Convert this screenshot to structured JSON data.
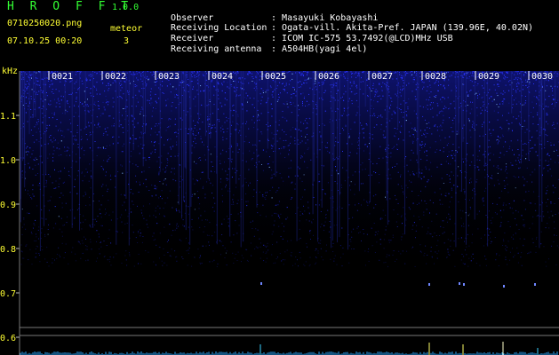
{
  "app": {
    "title": "H R O F F T",
    "version": "1.0.0"
  },
  "file": {
    "name": "0710250020.png",
    "datetime": "07.10.25 00:20"
  },
  "meteor": {
    "label": "meteor",
    "count": "3"
  },
  "info": [
    {
      "key": "Observer",
      "value": "Masayuki Kobayashi"
    },
    {
      "key": "Receiving Location",
      "value": "Ogata-vill. Akita-Pref. JAPAN (139.96E, 40.02N)"
    },
    {
      "key": "Receiver",
      "value": "ICOM IC-575 53.7492(@LCD)MHz USB"
    },
    {
      "key": "Receiving antenna",
      "value": "A504HB(yagi 4el)"
    }
  ],
  "axis": {
    "unit": "kHz",
    "y_ticks": [
      "1.1",
      "1.0",
      "0.9",
      "0.8",
      "0.7",
      "0.6"
    ],
    "x_ticks": [
      "0021",
      "0022",
      "0023",
      "0024",
      "0025",
      "0026",
      "0027",
      "0028",
      "0029",
      "0030"
    ]
  },
  "colors": {
    "background": "#000000",
    "header_text": "#ffff33",
    "title_green": "#33ff33",
    "noise": "#2a34ff",
    "grid": "#888888"
  }
}
